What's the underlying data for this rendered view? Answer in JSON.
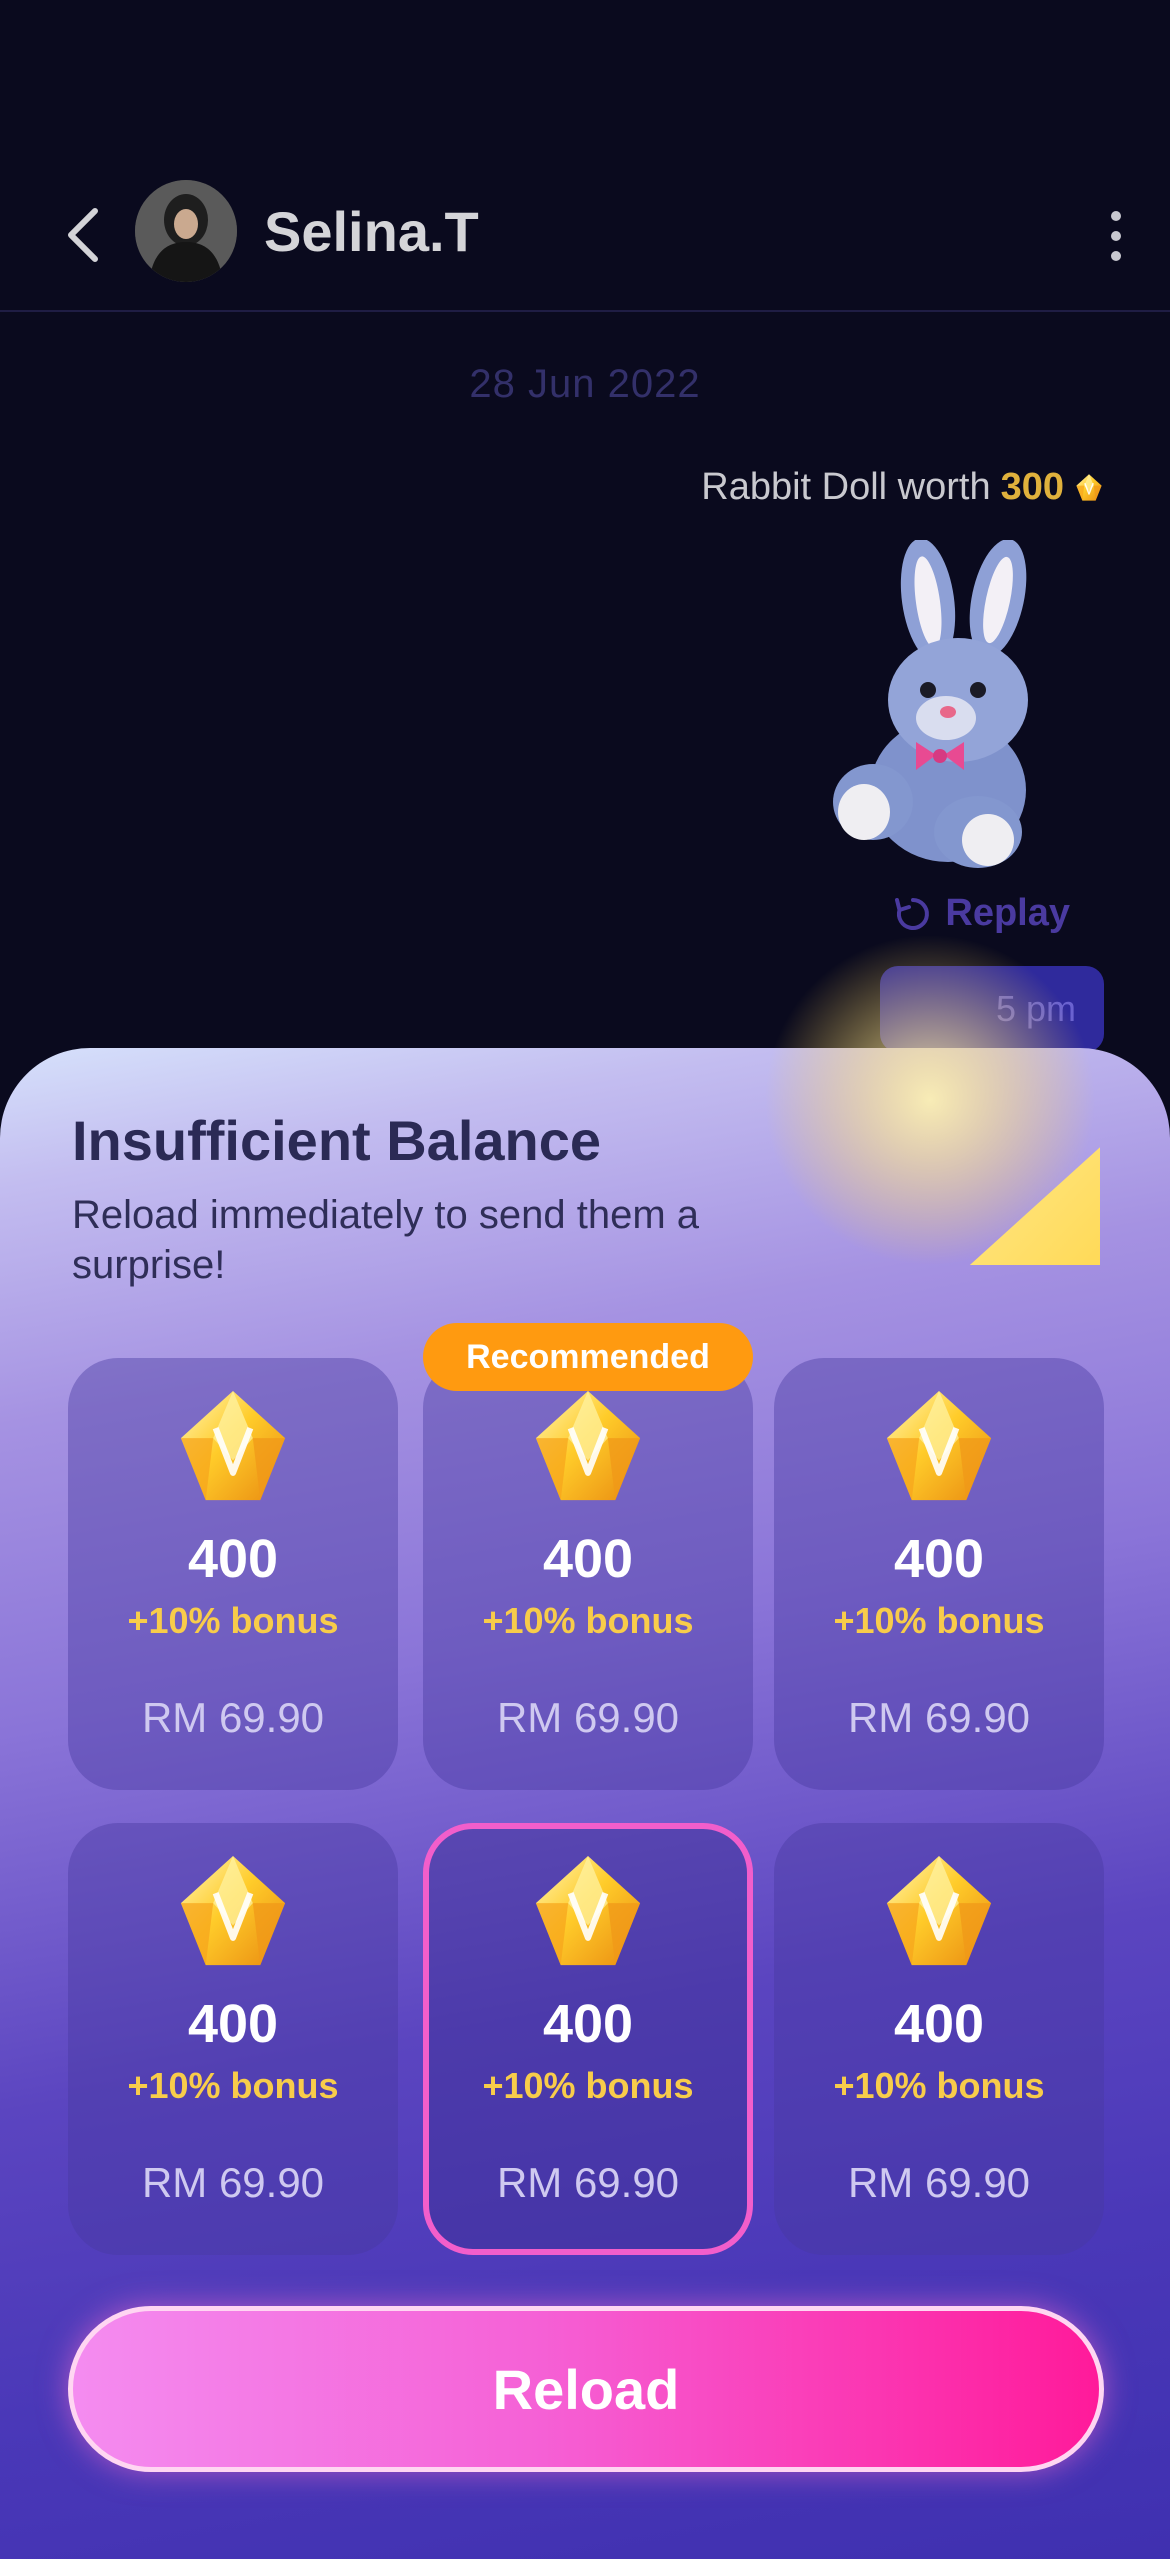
{
  "header": {
    "username": "Selina.T"
  },
  "chat": {
    "date": "28 Jun 2022",
    "gift_text": "Rabbit Doll worth",
    "gift_worth": "300",
    "replay_label": "Replay",
    "time_partial": "5 pm"
  },
  "sheet": {
    "title": "Insufficient Balance",
    "subtitle": "Reload immediately to send them a surprise!",
    "badge": "Recommended",
    "reload_label": "Reload"
  },
  "packages": [
    {
      "amount": "400",
      "bonus": "+10% bonus",
      "price": "RM 69.90"
    },
    {
      "amount": "400",
      "bonus": "+10% bonus",
      "price": "RM 69.90"
    },
    {
      "amount": "400",
      "bonus": "+10% bonus",
      "price": "RM 69.90"
    },
    {
      "amount": "400",
      "bonus": "+10% bonus",
      "price": "RM 69.90"
    },
    {
      "amount": "400",
      "bonus": "+10% bonus",
      "price": "RM 69.90"
    },
    {
      "amount": "400",
      "bonus": "+10% bonus",
      "price": "RM 69.90"
    }
  ],
  "colors": {
    "accent_gold": "#f8cc4a",
    "badge_orange": "#ff9a10",
    "selected_border": "#f25ecb",
    "reload_pink": "#ff1a9a"
  },
  "icons": {
    "back": "chevron-left-icon",
    "more": "more-vertical-icon",
    "replay": "replay-icon",
    "currency": "diamond-gem-icon"
  }
}
